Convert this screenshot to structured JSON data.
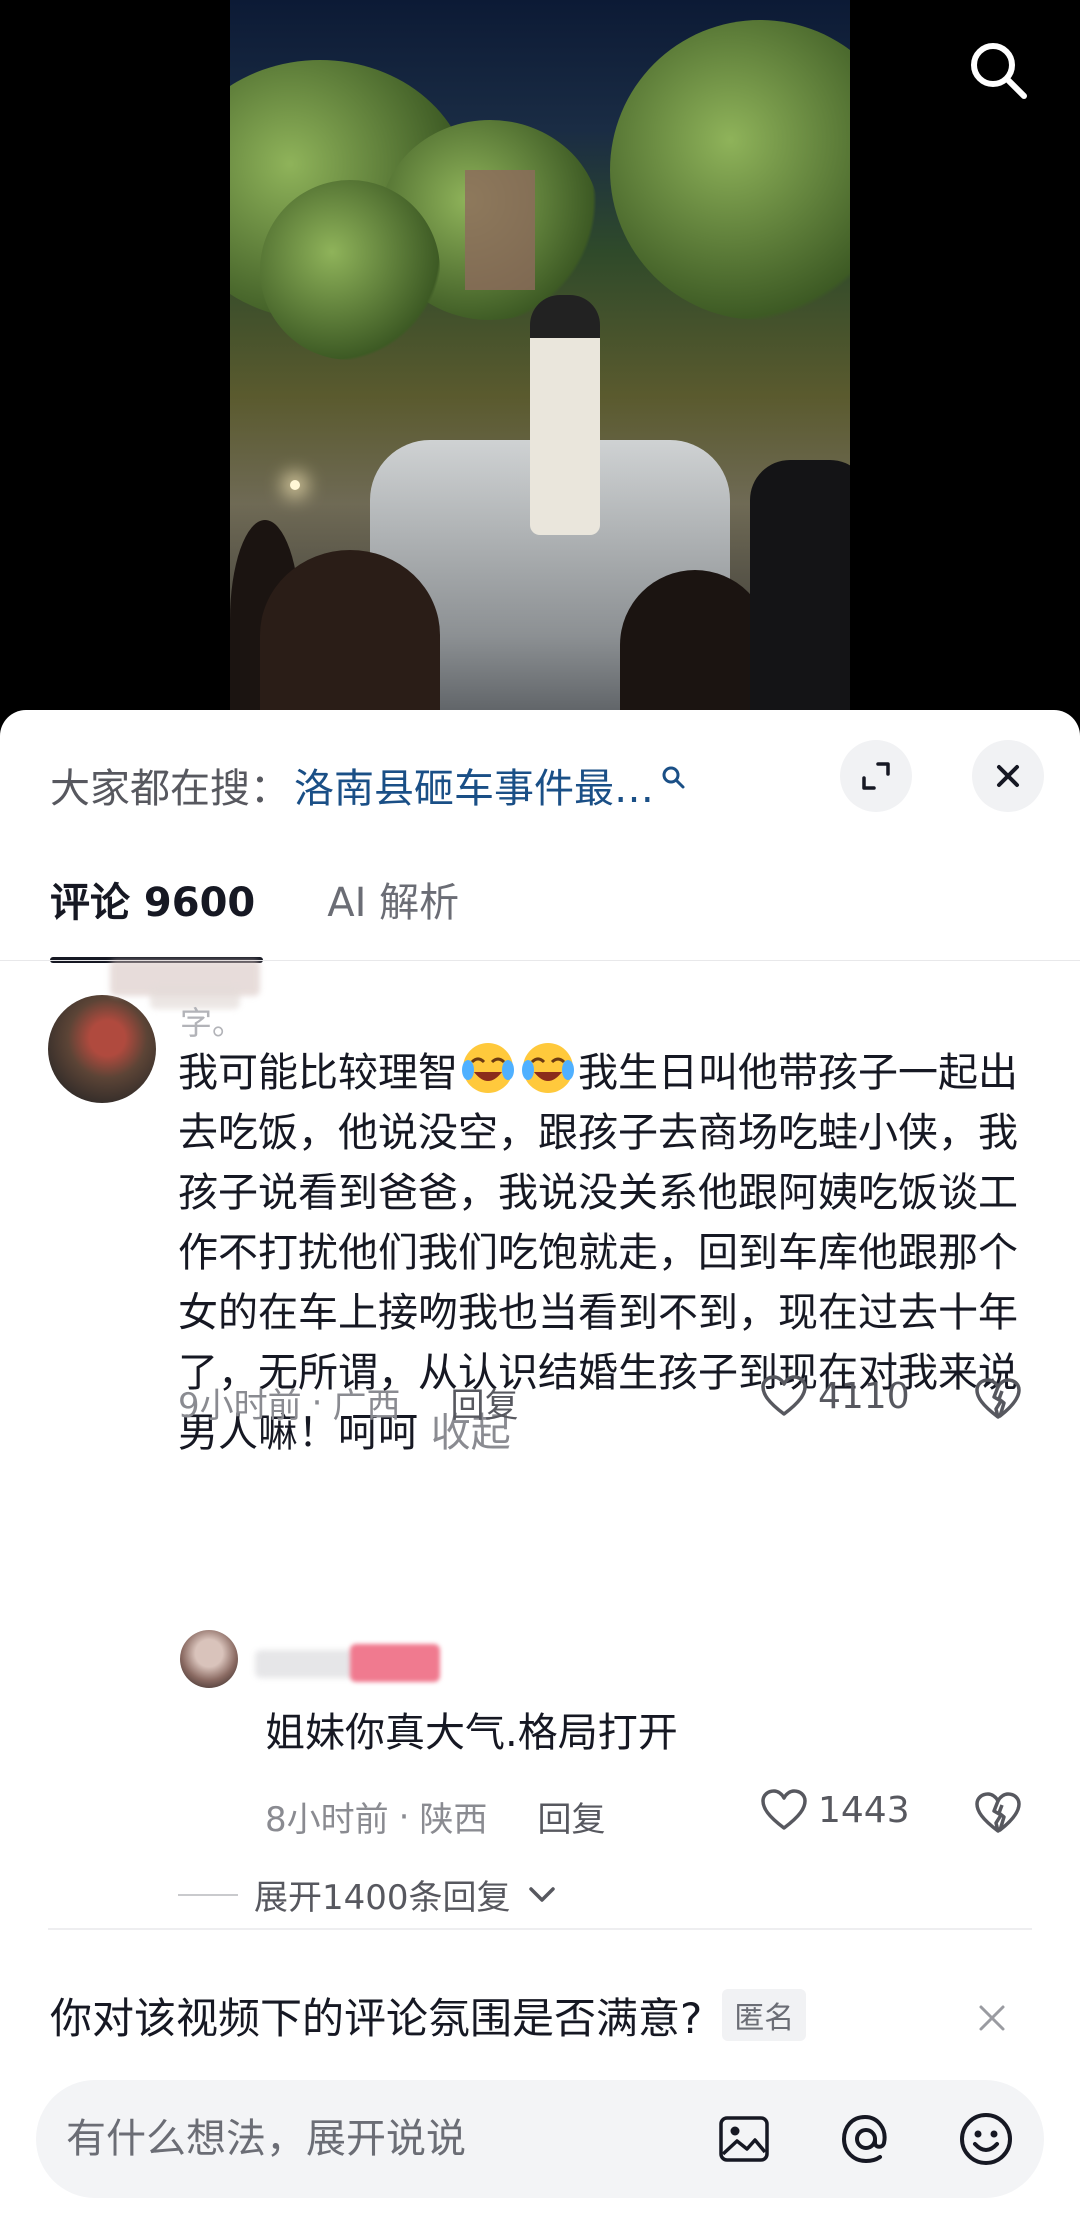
{
  "search_bar": {
    "prefix": "大家都在搜：",
    "term": "洛南县砸车事件最…"
  },
  "tabs": [
    {
      "label": "评论 9600",
      "active": true
    },
    {
      "label": "AI 解析",
      "active": false
    }
  ],
  "comment": {
    "nickname_suffix": "字。",
    "text_before_emoji": "我可能比较理智",
    "text_after_emoji": "我生日叫他带孩子一起出去吃饭，他说没空，跟孩子去商场吃蛙小侠，我孩子说看到爸爸，我说没关系他跟阿姨吃饭谈工作不打扰他们我们吃饱就走，回到车库他跟那个女的在车上接吻我也当看到不到，现在过去十年了，无所谓，从认识结婚生孩子到现在对我来说男人嘛！呵呵",
    "collapse_label": "收起",
    "time": "9小时前",
    "separator": "·",
    "location": "广西",
    "reply_label": "回复",
    "likes": "4110"
  },
  "reply": {
    "text": "姐妹你真大气.格局打开",
    "time": "8小时前",
    "separator": "·",
    "location": "陕西",
    "reply_label": "回复",
    "likes": "1443"
  },
  "expand_label": "展开1400条回复",
  "survey": {
    "question": "你对该视频下的评论氛围是否满意?",
    "badge": "匿名"
  },
  "input": {
    "placeholder": "有什么想法，展开说说"
  },
  "icons": {
    "top_right": "search-icon",
    "expand": "expand-icon",
    "close": "close-icon",
    "like": "heart-icon",
    "dislike": "broken-heart-icon",
    "image": "image-icon",
    "mention": "at-icon",
    "emoji": "emoji-icon"
  }
}
